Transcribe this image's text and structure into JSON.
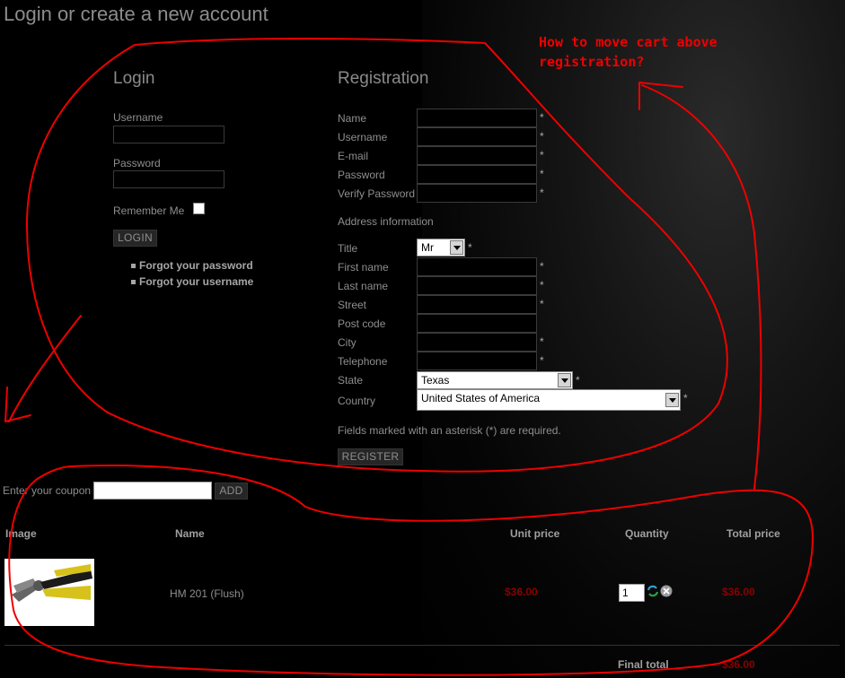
{
  "page": {
    "title": "Login or create a new account"
  },
  "login": {
    "heading": "Login",
    "username_label": "Username",
    "password_label": "Password",
    "remember_label": "Remember Me",
    "login_button": "LOGIN",
    "links": [
      "Forgot your password",
      "Forgot your username"
    ]
  },
  "registration": {
    "heading": "Registration",
    "account_fields": [
      "Name",
      "Username",
      "E-mail",
      "Password",
      "Verify Password"
    ],
    "address_heading": "Address information",
    "title_label": "Title",
    "title_value": "Mr",
    "address_fields": [
      {
        "label": "First name",
        "required": "*"
      },
      {
        "label": "Last name",
        "required": "*"
      },
      {
        "label": "Street",
        "required": "*"
      },
      {
        "label": "Post code",
        "required": ""
      },
      {
        "label": "City",
        "required": "*"
      },
      {
        "label": "Telephone",
        "required": "*"
      }
    ],
    "state_label": "State",
    "state_value": "Texas",
    "country_label": "Country",
    "country_value": "United States of America",
    "required_marker": "*",
    "note": "Fields marked with an asterisk (*) are required.",
    "register_button": "REGISTER"
  },
  "coupon": {
    "label": "Enter your coupon",
    "button": "ADD"
  },
  "cart": {
    "headers": [
      "Image",
      "Name",
      "Unit price",
      "Quantity",
      "Total price"
    ],
    "items": [
      {
        "name": "HM 201 (Flush)",
        "unit_price": "$36.00",
        "quantity": "1",
        "total": "$36.00"
      }
    ],
    "final_label": "Final total",
    "final_total": "$36.00"
  },
  "annotation": {
    "line1": "How to move cart above",
    "line2": "registration?"
  },
  "colors": {
    "annotation": "#e00000",
    "price": "#8a0000",
    "background": "#000000"
  }
}
